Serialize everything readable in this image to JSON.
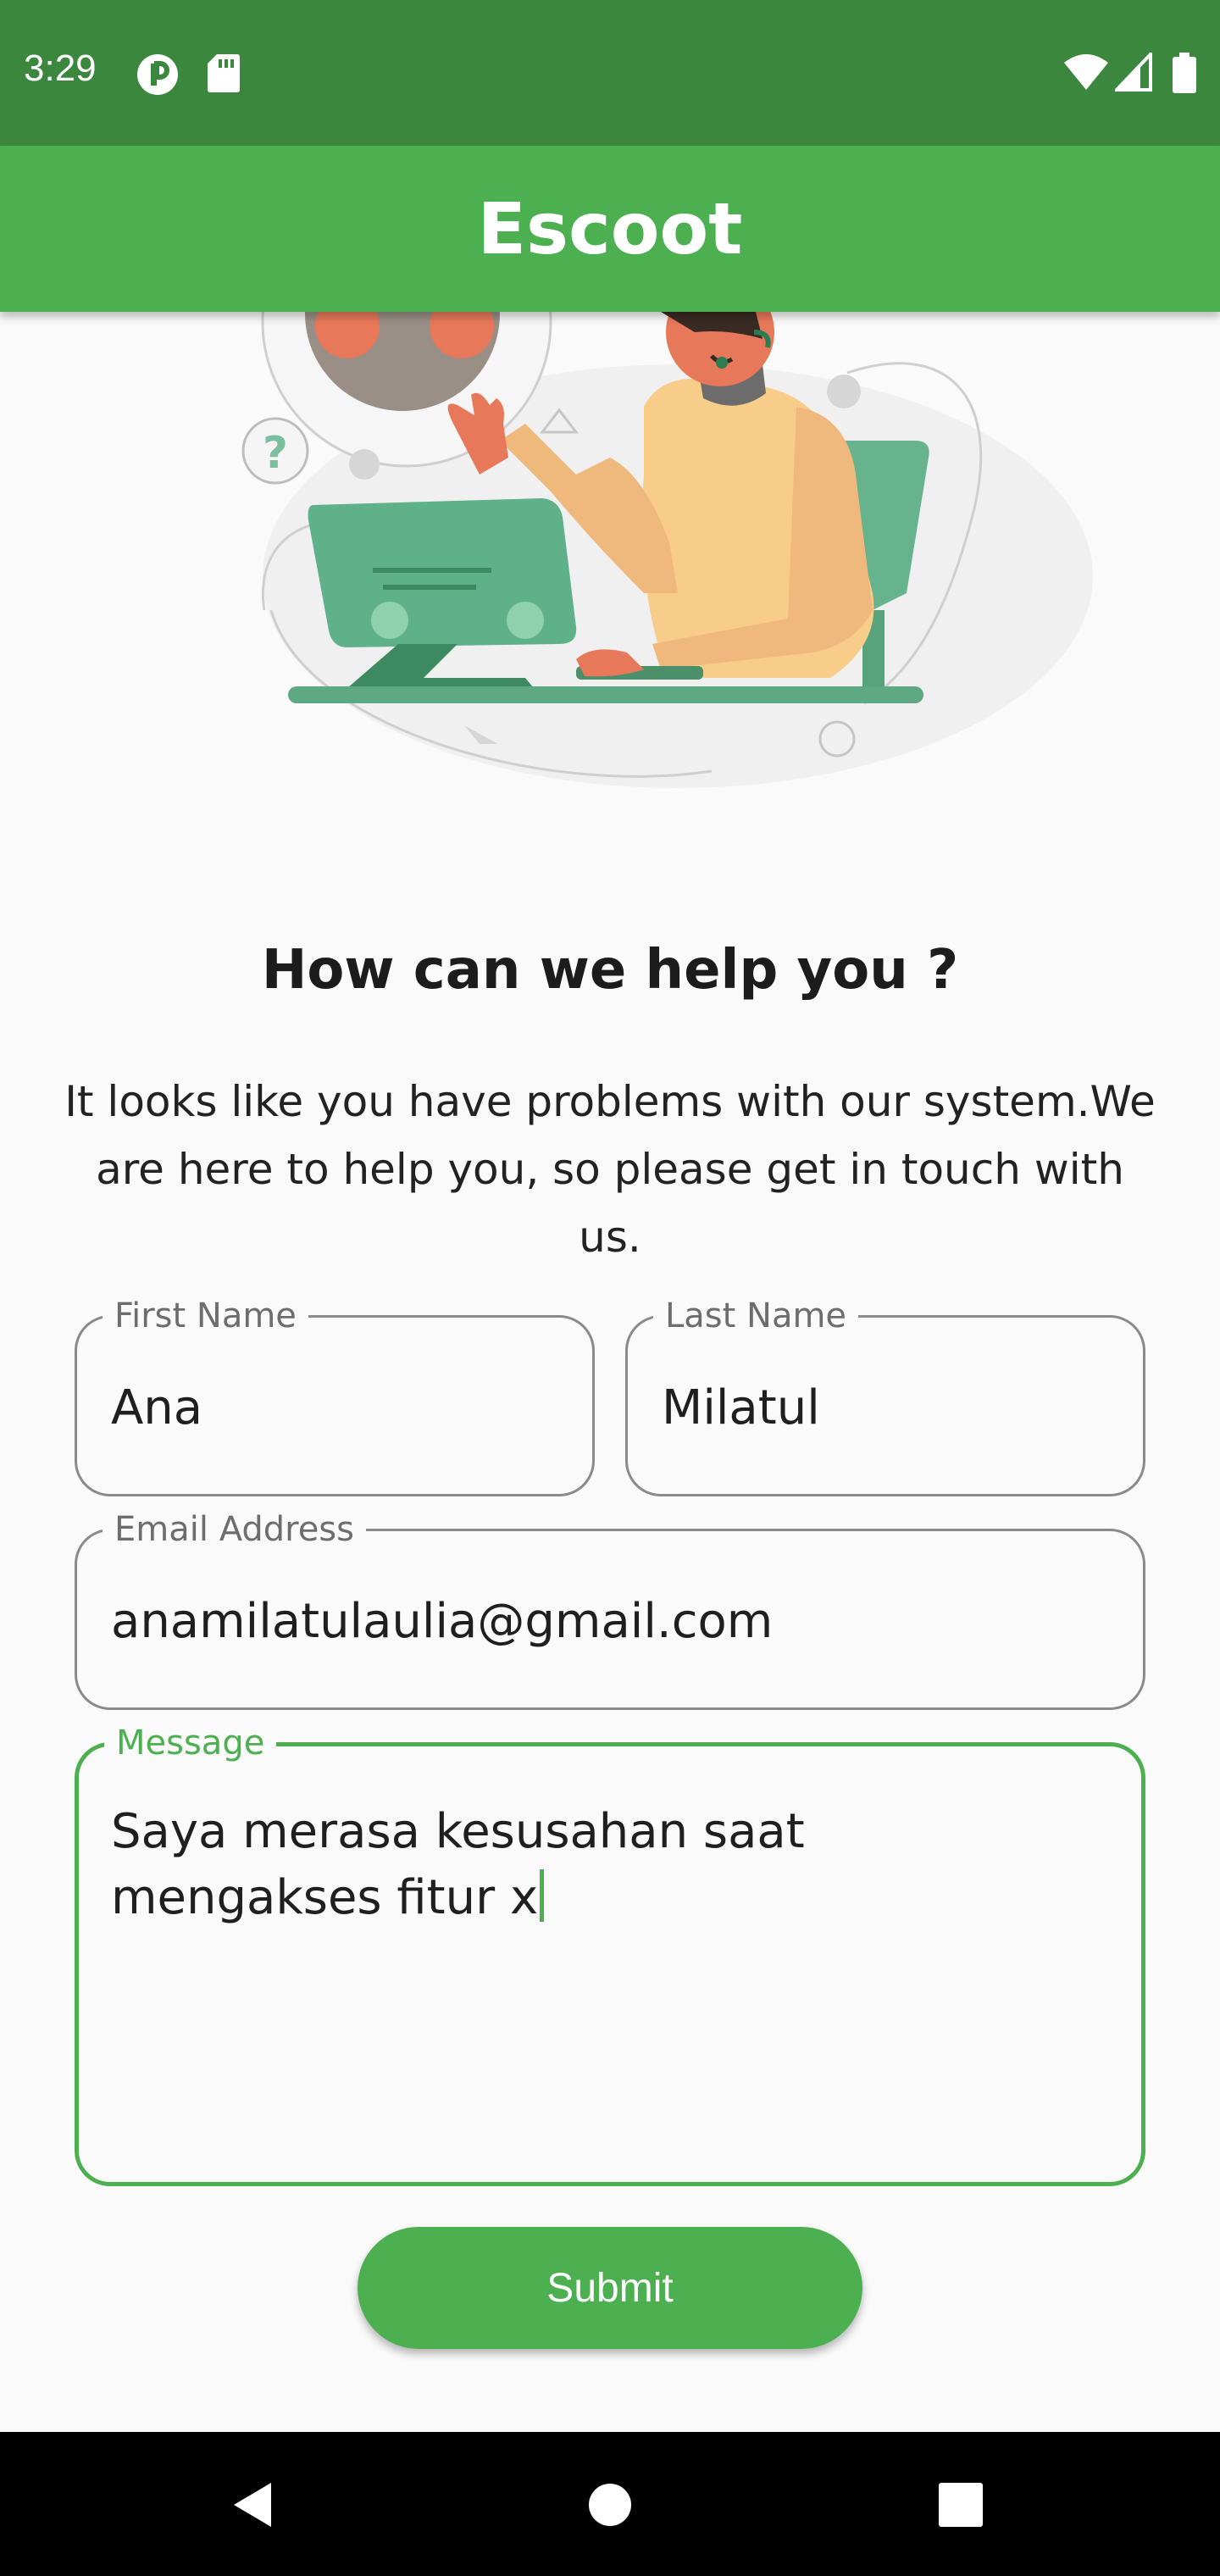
{
  "status_bar": {
    "time": "3:29"
  },
  "app_bar": {
    "title": "Escoot"
  },
  "content": {
    "heading": "How can we help you ?",
    "description": "It looks like you have problems with our system.We are here to help you, so please get in touch with us."
  },
  "form": {
    "first_name": {
      "label": "First Name",
      "value": "Ana"
    },
    "last_name": {
      "label": "Last Name",
      "value": "Milatul"
    },
    "email": {
      "label": "Email Address",
      "value": "anamilatulaulia@gmail.com"
    },
    "message": {
      "label": "Message",
      "value": "Saya merasa kesusahan saat\nmengakses fitur x"
    },
    "submit_label": "Submit"
  },
  "colors": {
    "accent": "#4caf50",
    "status_bar": "#3c873e",
    "nav_bar": "#000000"
  },
  "icons": [
    "data-saver-icon",
    "sd-card-icon",
    "wifi-icon",
    "cell-signal-icon",
    "battery-icon",
    "back-icon",
    "home-icon",
    "recents-icon"
  ]
}
